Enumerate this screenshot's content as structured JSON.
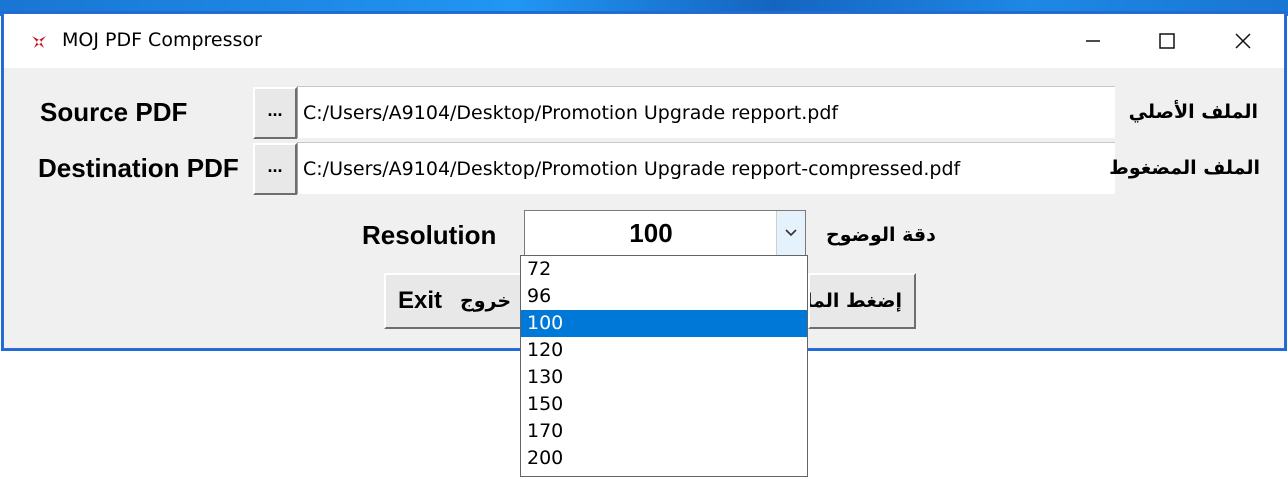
{
  "window": {
    "title": "MOJ PDF Compressor",
    "controls": {
      "minimize": "—",
      "maximize": "☐",
      "close": "✕"
    }
  },
  "source": {
    "label": "Source PDF",
    "label_ar": "الملف الأصلي",
    "browse_label": "...",
    "path": "C:/Users/A9104/Desktop/Promotion Upgrade repport.pdf"
  },
  "destination": {
    "label": "Destination PDF",
    "label_ar": "الملف المضغوط",
    "browse_label": "...",
    "path": "C:/Users/A9104/Desktop/Promotion Upgrade repport-compressed.pdf"
  },
  "resolution": {
    "label": "Resolution",
    "label_ar": "دقة الوضوح",
    "selected": "100",
    "options": [
      "72",
      "96",
      "100",
      "120",
      "130",
      "150",
      "170",
      "200"
    ],
    "selected_index": 2
  },
  "actions": {
    "exit_label": "Exit",
    "exit_label_ar": "خروج",
    "compress_label_ar": "إضغط الملف"
  },
  "colors": {
    "accent": "#0078d7",
    "app_icon": "#c0141c"
  }
}
